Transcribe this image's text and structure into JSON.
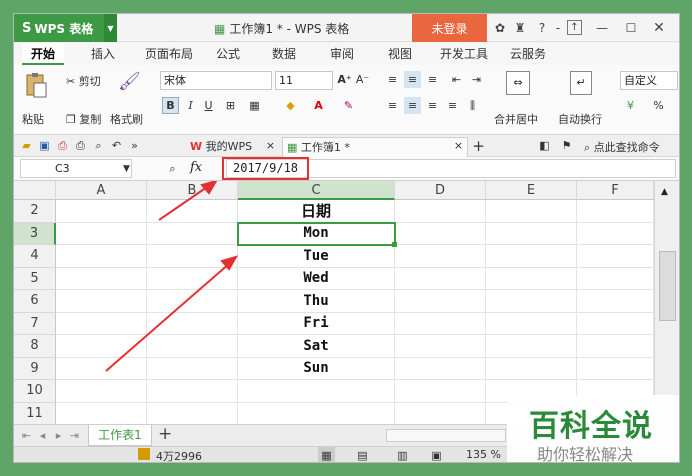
{
  "titlebar": {
    "app_name": "WPS 表格",
    "doc_title": "工作簿1 * - WPS 表格",
    "login_label": "未登录",
    "help_label": "?"
  },
  "menu_tabs": [
    "开始",
    "插入",
    "页面布局",
    "公式",
    "数据",
    "审阅",
    "视图",
    "开发工具",
    "云服务"
  ],
  "ribbon": {
    "paste_label": "粘贴",
    "cut_label": "剪切",
    "copy_label": "复制",
    "format_painter_label": "格式刷",
    "font_name": "宋体",
    "font_size": "11",
    "merge_center_label": "合并居中",
    "wrap_text_label": "自动换行",
    "number_format": "自定义",
    "percent_symbol": "%"
  },
  "doc_tabs": {
    "my_wps": "我的WPS",
    "workbook": "工作簿1 *",
    "search_label": "点此查找命令"
  },
  "formula_bar": {
    "cell_ref": "C3",
    "fx_label": "fx",
    "value": "2017/9/18"
  },
  "columns": [
    "A",
    "B",
    "C",
    "D",
    "E",
    "F"
  ],
  "rows": [
    "2",
    "3",
    "4",
    "5",
    "6",
    "7",
    "8",
    "9",
    "10",
    "11"
  ],
  "column_c_values": [
    "日期",
    "Mon",
    "Tue",
    "Wed",
    "Thu",
    "Fri",
    "Sat",
    "Sun",
    "",
    ""
  ],
  "sheet_tabs": {
    "active_sheet": "工作表1",
    "add_label": "+"
  },
  "status": {
    "sum_text": "4万2996",
    "zoom_text": "135 %"
  },
  "watermark": {
    "title": "百科全说",
    "subtitle": "助你轻松解决"
  },
  "colors": {
    "accent": "#3c9a44",
    "highlight_red": "#e53030",
    "login_orange": "#e9663f"
  }
}
